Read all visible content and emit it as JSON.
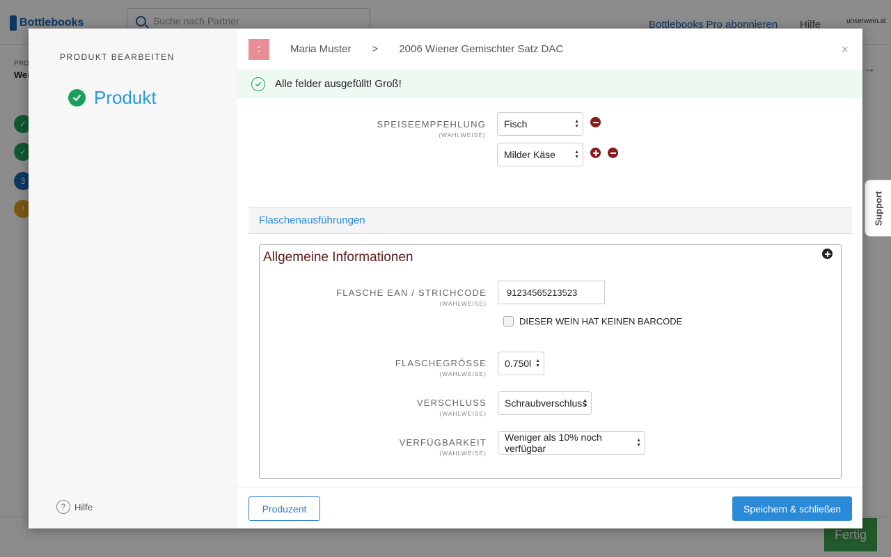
{
  "background": {
    "logo": "Bottlebooks",
    "search_placeholder": "Suche nach Partner",
    "pro_link": "Bottlebooks Pro abonnieren",
    "help_link": "Hilfe",
    "brand_name": "unserwein.at",
    "sub_label_top": "PRO",
    "sub_label_main": "Wei",
    "steps": [
      {
        "text": "✓",
        "color": "#1aa05b"
      },
      {
        "text": "✓",
        "color": "#1aa05b"
      },
      {
        "text": "3",
        "color": "#1b66b1"
      },
      {
        "text": "!",
        "color": "#e0a020"
      }
    ],
    "support_tab": "Support",
    "fertig_button": "Fertig"
  },
  "sidebar": {
    "title": "PRODUKT BEARBEITEN",
    "step_label": "Produkt",
    "help_label": "Hilfe"
  },
  "header": {
    "producer_name": "Maria Muster",
    "separator": ">",
    "product_name": "2006 Wiener Gemischter Satz DAC",
    "close": "×"
  },
  "banner": {
    "text": "Alle felder ausgefüllt! Groß!"
  },
  "food_pairing": {
    "label": "SPEISEEMPFEHLUNG",
    "optional": "(WAHLWEISE)",
    "items": [
      "Fisch",
      "Milder Käse"
    ]
  },
  "section": {
    "title": "Flaschenausführungen"
  },
  "general_info": {
    "title": "Allgemeine Informationen",
    "ean_label": "FLASCHE EAN / STRICHCODE",
    "ean_optional": "(WAHLWEISE)",
    "ean_value": "91234565213523",
    "no_barcode_label": "DIESER WEIN HAT KEINEN BARCODE",
    "size_label": "FLASCHEGRÖSSE",
    "size_optional": "(WAHLWEISE)",
    "size_value": "0.750l",
    "closure_label": "VERSCHLUSS",
    "closure_optional": "(WAHLWEISE)",
    "closure_value": "Schraubverschluss",
    "availability_label": "VERFÜGBARKEIT",
    "availability_optional": "(WAHLWEISE)",
    "availability_value": "Weniger als 10% noch verfügbar"
  },
  "footer": {
    "producer_button": "Produzent",
    "save_button": "Speichern & schließen"
  },
  "colors": {
    "accent": "#2a8ad8",
    "success": "#1aa05b",
    "danger": "#8b1a1a"
  }
}
